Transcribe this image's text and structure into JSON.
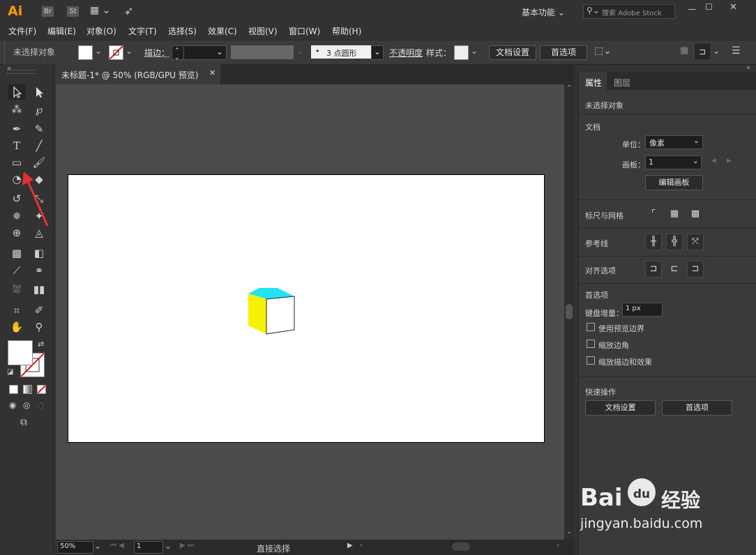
{
  "app": {
    "logo": "Ai",
    "bridge": "Br",
    "stock": "St"
  },
  "titlebar": {
    "workspace": "基本功能",
    "search_placeholder": "搜索 Adobe Stock",
    "minimize": "—",
    "restore": "☐",
    "close": "✕"
  },
  "menu": [
    "文件(F)",
    "编辑(E)",
    "对象(O)",
    "文字(T)",
    "选择(S)",
    "效果(C)",
    "视图(V)",
    "窗口(W)",
    "帮助(H)"
  ],
  "control": {
    "no_selection": "未选择对象",
    "stroke_label": "描边：",
    "brush_dot": "•",
    "brush_label": "3 点圆形",
    "opacity_label": "不透明度",
    "style_label": "样式：",
    "doc_setup": "文档设置",
    "preferences": "首选项"
  },
  "document": {
    "tab_title": "未标题-1* @ 50% (RGB/GPU 预览)",
    "tab_close": "✕"
  },
  "cube": {
    "top_color": "#20e4f2",
    "left_color": "#f7f200",
    "front_color": "#ffffff"
  },
  "annotation": {
    "arrow_color": "#e53030"
  },
  "status": {
    "zoom": "50%",
    "artboard_num": "1",
    "tool": "直接选择"
  },
  "panel": {
    "tabs": [
      "属性",
      "图层"
    ],
    "no_selection": "未选择对象",
    "document_heading": "文档",
    "unit_label": "单位：",
    "unit_value": "像素",
    "artboard_label": "画板：",
    "artboard_value": "1",
    "edit_artboards": "编辑画板",
    "rulers_grid": "标尺与网格",
    "guides": "参考线",
    "align_options": "对齐选项",
    "prefs_heading": "首选项",
    "keyboard_increment_label": "键盘增量：",
    "keyboard_increment_value": "1 px",
    "checkboxes": [
      "使用预览边界",
      "缩放边角",
      "缩放描边和效果"
    ],
    "quick_actions": "快速操作",
    "doc_setup_btn": "文档设置",
    "prefs_btn": "首选项"
  },
  "watermark": {
    "brand": "Bai",
    "paw": "du",
    "cn": "经验",
    "url": "jingyan.baidu.com"
  }
}
